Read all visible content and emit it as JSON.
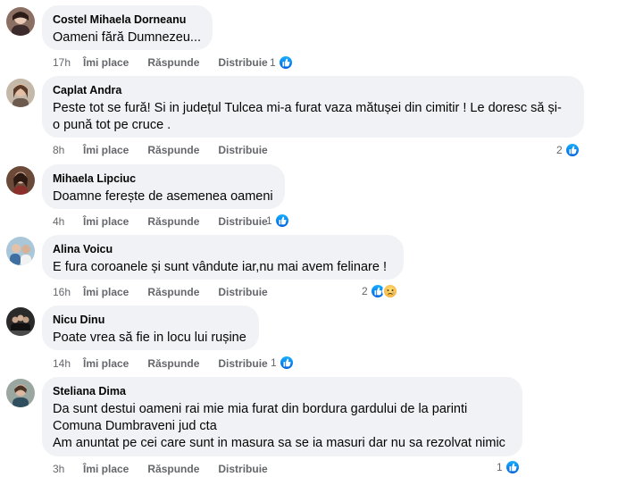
{
  "labels": {
    "like": "Îmi place",
    "reply": "Răspunde",
    "share": "Distribuie"
  },
  "comments": [
    {
      "author": "Costel Mihaela Dorneanu",
      "text": "Oameni fără Dumnezeu...",
      "time": "17h",
      "reaction_count": "1",
      "reactions": [
        "like-icon"
      ]
    },
    {
      "author": "Caplat Andra",
      "text": "Peste tot se fură! Si in județul Tulcea mi-a furat vaza mătușei din cimitir ! Le doresc să și-\no pună tot pe cruce .",
      "time": "8h",
      "reaction_count": "2",
      "reactions": [
        "like-icon"
      ]
    },
    {
      "author": "Mihaela Lipciuc",
      "text": "Doamne ferește de asemenea oameni",
      "time": "4h",
      "reaction_count": "1",
      "reactions": [
        "like-icon"
      ]
    },
    {
      "author": "Alina Voicu",
      "text": "E fura coroanele și sunt vândute iar,nu mai avem felinare !",
      "time": "16h",
      "reaction_count": "2",
      "reactions": [
        "like-icon",
        "sad-icon"
      ]
    },
    {
      "author": "Nicu Dinu",
      "text": "Poate vrea să fie in locu lui rușine",
      "time": "14h",
      "reaction_count": "1",
      "reactions": [
        "like-icon"
      ]
    },
    {
      "author": "Steliana Dima",
      "text": "Da sunt destui oameni rai mie mia furat din bordura gardului de la parinti\nComuna Dumbraveni jud cta\nAm anuntat pe cei care sunt in masura sa se ia masuri dar nu sa rezolvat nimic",
      "time": "3h",
      "reaction_count": "1",
      "reactions": [
        "like-icon"
      ]
    }
  ],
  "colors": {
    "bubble": "#f0f2f5",
    "secondary_text": "#65676b",
    "like_blue": "#0866ff"
  }
}
